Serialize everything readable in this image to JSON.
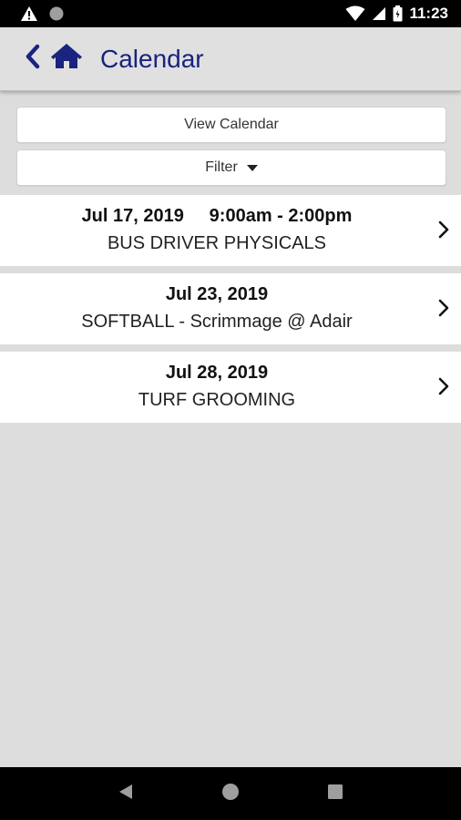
{
  "status_bar": {
    "time": "11:23"
  },
  "app_bar": {
    "title": "Calendar"
  },
  "actions": {
    "view_calendar_label": "View Calendar",
    "filter_label": "Filter"
  },
  "events": [
    {
      "date": "Jul 17, 2019",
      "time": "9:00am - 2:00pm",
      "title": "BUS DRIVER PHYSICALS"
    },
    {
      "date": "Jul 23, 2019",
      "time": "",
      "title": "SOFTBALL - Scrimmage @ Adair"
    },
    {
      "date": "Jul 28, 2019",
      "time": "",
      "title": "TURF GROOMING"
    }
  ],
  "colors": {
    "accent": "#1a237e",
    "background": "#dddddd"
  },
  "icons": [
    "warning-icon",
    "record-icon",
    "wifi-icon",
    "cell-signal-icon",
    "battery-icon",
    "back-chevron-icon",
    "home-icon",
    "caret-down-icon",
    "chevron-right-icon",
    "nav-back-icon",
    "nav-home-icon",
    "nav-recents-icon"
  ]
}
